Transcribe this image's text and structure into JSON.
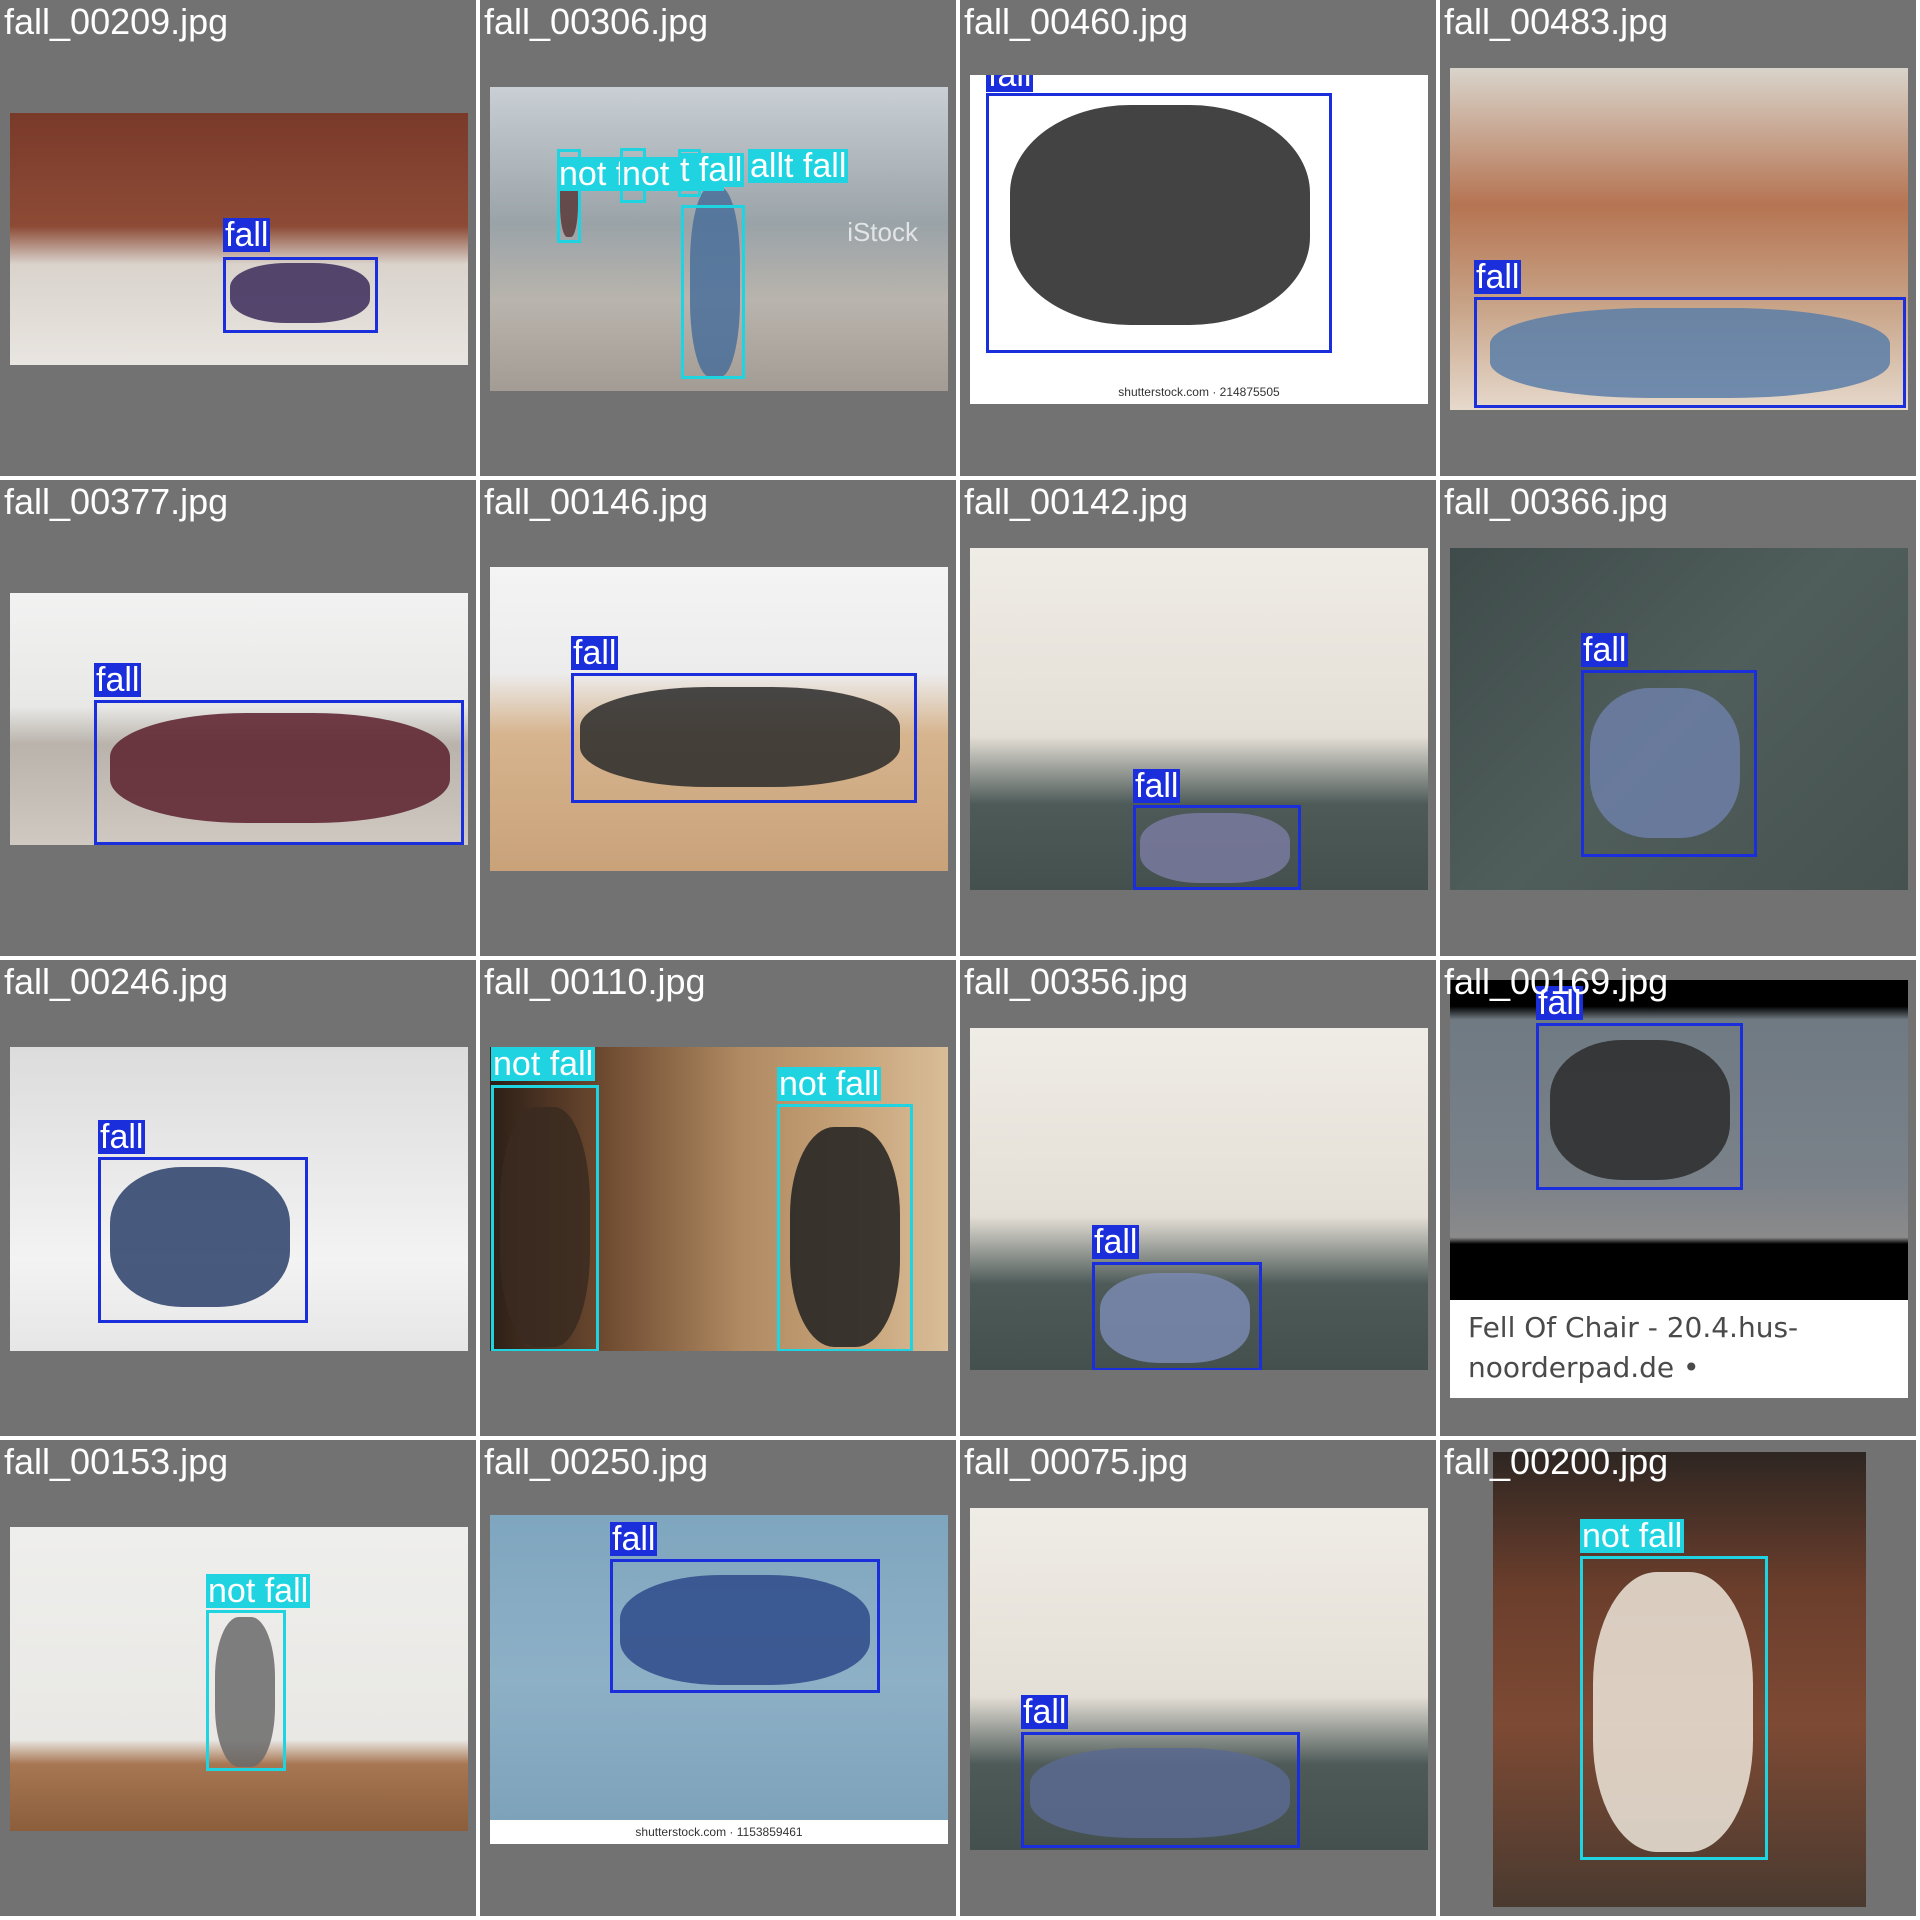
{
  "colors": {
    "tile_bg": "#727272",
    "fall": "#1a2edb",
    "not_fall": "#1fd4e0"
  },
  "tiles": [
    {
      "filename": "fall_00209.jpg",
      "photo": {
        "grad": "linear-gradient(180deg,#7a3a2a 0%,#8d4b36 45%,#d9d3cc 60%,#e9e5e0 100%)"
      },
      "boxes": [
        {
          "label": "fall",
          "cls": "fall"
        }
      ]
    },
    {
      "filename": "fall_00306.jpg",
      "photo": {
        "grad": "linear-gradient(180deg,#c9cfd4 0%,#9aa3a8 45%,#b9b4ad 70%,#a39c94 100%)",
        "text": "iStock"
      },
      "boxes": [
        {
          "label": "not fall",
          "cls": "not_fall"
        },
        {
          "label": "not fall",
          "cls": "not_fall"
        },
        {
          "label": "t fall",
          "cls": "not_fall"
        },
        {
          "label": "allt fall",
          "cls": "not_fall"
        }
      ]
    },
    {
      "filename": "fall_00460.jpg",
      "photo": {
        "grad": "linear-gradient(180deg,#ffffff 0%,#ffffff 100%)",
        "text": "shutterstock.com · 214875505"
      },
      "boxes": [
        {
          "label": "fall",
          "cls": "fall"
        }
      ]
    },
    {
      "filename": "fall_00483.jpg",
      "photo": {
        "grad": "linear-gradient(180deg,#d9d4cb 0%,#b57452 40%,#c8a488 70%,#e6d9cc 100%)"
      },
      "boxes": [
        {
          "label": "fall",
          "cls": "fall"
        }
      ]
    },
    {
      "filename": "fall_00377.jpg",
      "photo": {
        "grad": "linear-gradient(180deg,#f2f2f2 0%,#e8e8e6 45%,#b9b3ab 60%,#cfc9c2 100%)"
      },
      "boxes": [
        {
          "label": "fall",
          "cls": "fall"
        }
      ]
    },
    {
      "filename": "fall_00146.jpg",
      "photo": {
        "grad": "linear-gradient(180deg,#f4f4f4 0%,#ececec 35%,#d6b48e 55%,#c9a27a 100%)"
      },
      "boxes": [
        {
          "label": "fall",
          "cls": "fall"
        }
      ]
    },
    {
      "filename": "fall_00142.jpg",
      "photo": {
        "grad": "linear-gradient(180deg,#efece6 0%,#e4dfd6 55%,#4d5a58 75%,#44504e 100%)"
      },
      "boxes": [
        {
          "label": "fall",
          "cls": "fall"
        }
      ]
    },
    {
      "filename": "fall_00366.jpg",
      "photo": {
        "grad": "linear-gradient(135deg,#3e4b4a 0%,#4f5d5b 50%,#46524f 100%)"
      },
      "boxes": [
        {
          "label": "fall",
          "cls": "fall"
        }
      ]
    },
    {
      "filename": "fall_00246.jpg",
      "photo": {
        "grad": "linear-gradient(180deg,#dcdcdc 0%,#e9e9e9 40%,#f3f3f3 70%,#e6e6e6 100%)"
      },
      "boxes": [
        {
          "label": "fall",
          "cls": "fall"
        }
      ]
    },
    {
      "filename": "fall_00110.jpg",
      "photo": {
        "grad": "linear-gradient(90deg,#2b1e16 0%,#6e4a30 25%,#b08a62 55%,#c8a47a 80%,#d8bd98 100%)"
      },
      "boxes": [
        {
          "label": "not fall",
          "cls": "not_fall"
        },
        {
          "label": "not fall",
          "cls": "not_fall"
        }
      ]
    },
    {
      "filename": "fall_00356.jpg",
      "photo": {
        "grad": "linear-gradient(180deg,#efece6 0%,#e4dfd6 55%,#4d5a58 75%,#44504e 100%)"
      },
      "boxes": [
        {
          "label": "fall",
          "cls": "fall"
        }
      ]
    },
    {
      "filename": "fall_00169.jpg",
      "photo": {
        "grad": "linear-gradient(180deg,#000000 0%,#000000 8%,#6f7a83 12%,#7a8189 60%,#8a8a8a 78%,#000000 80%,#000000 100%)"
      },
      "caption": "Fell Of Chair - 20.4.hus-noorderpad.de •",
      "boxes": [
        {
          "label": "fall",
          "cls": "fall"
        }
      ]
    },
    {
      "filename": "fall_00153.jpg",
      "photo": {
        "grad": "linear-gradient(180deg,#eeeeec 0%,#e9e8e5 70%,#a77652 78%,#8c5e3c 100%)"
      },
      "boxes": [
        {
          "label": "not fall",
          "cls": "not_fall"
        }
      ]
    },
    {
      "filename": "fall_00250.jpg",
      "photo": {
        "grad": "linear-gradient(180deg,#7fa6bf 0%,#8db0c6 50%,#7aa0b8 100%)",
        "text": "shutterstock.com · 1153859461"
      },
      "boxes": [
        {
          "label": "fall",
          "cls": "fall"
        }
      ]
    },
    {
      "filename": "fall_00075.jpg",
      "photo": {
        "grad": "linear-gradient(180deg,#efece6 0%,#e4dfd6 55%,#4d5a58 75%,#44504e 100%)"
      },
      "boxes": [
        {
          "label": "fall",
          "cls": "fall"
        }
      ]
    },
    {
      "filename": "fall_00200.jpg",
      "photo": {
        "grad": "linear-gradient(180deg,#2e2622 0%,#6b3e2c 30%,#7d4a34 60%,#4a3a30 100%)"
      },
      "boxes": [
        {
          "label": "not fall",
          "cls": "not_fall"
        }
      ]
    }
  ]
}
